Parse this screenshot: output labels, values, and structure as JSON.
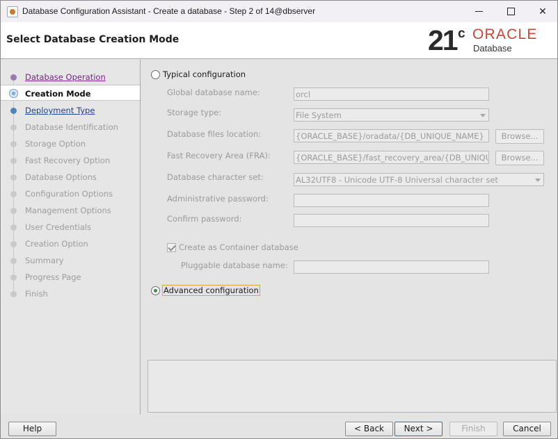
{
  "window": {
    "title": "Database Configuration Assistant - Create a database - Step 2 of 14@dbserver",
    "controls": {
      "minimize": "",
      "maximize": "",
      "close": "✕"
    }
  },
  "header": {
    "title": "Select Database Creation Mode",
    "logo": {
      "version": "21",
      "version_suffix": "c",
      "brand": "ORACLE",
      "product": "Database",
      "brand_color": "#c74634"
    }
  },
  "nav": {
    "items": [
      {
        "label": "Database Operation",
        "state": "visited"
      },
      {
        "label": "Creation Mode",
        "state": "current"
      },
      {
        "label": "Deployment Type",
        "state": "link"
      },
      {
        "label": "Database Identification",
        "state": "disabled"
      },
      {
        "label": "Storage Option",
        "state": "disabled"
      },
      {
        "label": "Fast Recovery Option",
        "state": "disabled"
      },
      {
        "label": "Database Options",
        "state": "disabled"
      },
      {
        "label": "Configuration Options",
        "state": "disabled"
      },
      {
        "label": "Management Options",
        "state": "disabled"
      },
      {
        "label": "User Credentials",
        "state": "disabled"
      },
      {
        "label": "Creation Option",
        "state": "disabled"
      },
      {
        "label": "Summary",
        "state": "disabled"
      },
      {
        "label": "Progress Page",
        "state": "disabled"
      },
      {
        "label": "Finish",
        "state": "disabled"
      }
    ]
  },
  "typical": {
    "label": "Typical configuration",
    "selected": false,
    "global_db_name": {
      "label": "Global database name:",
      "value": "orcl"
    },
    "storage_type": {
      "label": "Storage type:",
      "value": "File System"
    },
    "db_files_location": {
      "label": "Database files location:",
      "value": "{ORACLE_BASE}/oradata/{DB_UNIQUE_NAME}",
      "browse": "Browse..."
    },
    "fra": {
      "label": "Fast Recovery Area (FRA):",
      "value": "{ORACLE_BASE}/fast_recovery_area/{DB_UNIQU",
      "browse": "Browse..."
    },
    "charset": {
      "label": "Database character set:",
      "value": "AL32UTF8 - Unicode UTF-8 Universal character set"
    },
    "admin_password": {
      "label": "Administrative password:",
      "value": ""
    },
    "confirm_password": {
      "label": "Confirm password:",
      "value": ""
    },
    "container_db": {
      "label": "Create as Container database",
      "checked": true
    },
    "pdb_name": {
      "label": "Pluggable database name:",
      "value": ""
    }
  },
  "advanced": {
    "label": "Advanced configuration",
    "selected": true
  },
  "buttons": {
    "help": "Help",
    "back": "< Back",
    "next": "Next >",
    "finish": "Finish",
    "cancel": "Cancel"
  }
}
